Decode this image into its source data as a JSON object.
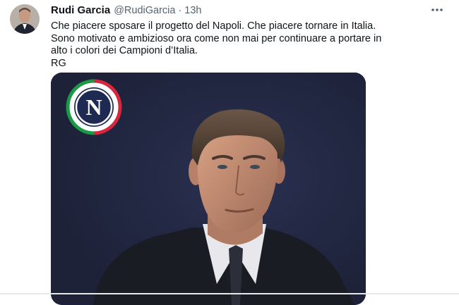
{
  "tweet": {
    "author": {
      "name": "Rudi Garcia",
      "handle": "@RudiGarcia",
      "separator": "·",
      "time": "13h"
    },
    "text_lines": [
      "Che piacere sposare il progetto del Napoli. Che piacere tornare in Italia.",
      "Sono motivato e ambizioso ora come non mai per continuare a portare in",
      "alto i colori dei Campioni d’Italia.",
      "RG"
    ],
    "media": {
      "logo_letter": "N",
      "background_color": "#20263f"
    },
    "icons": {
      "more": "more-horizontal-icon"
    }
  }
}
